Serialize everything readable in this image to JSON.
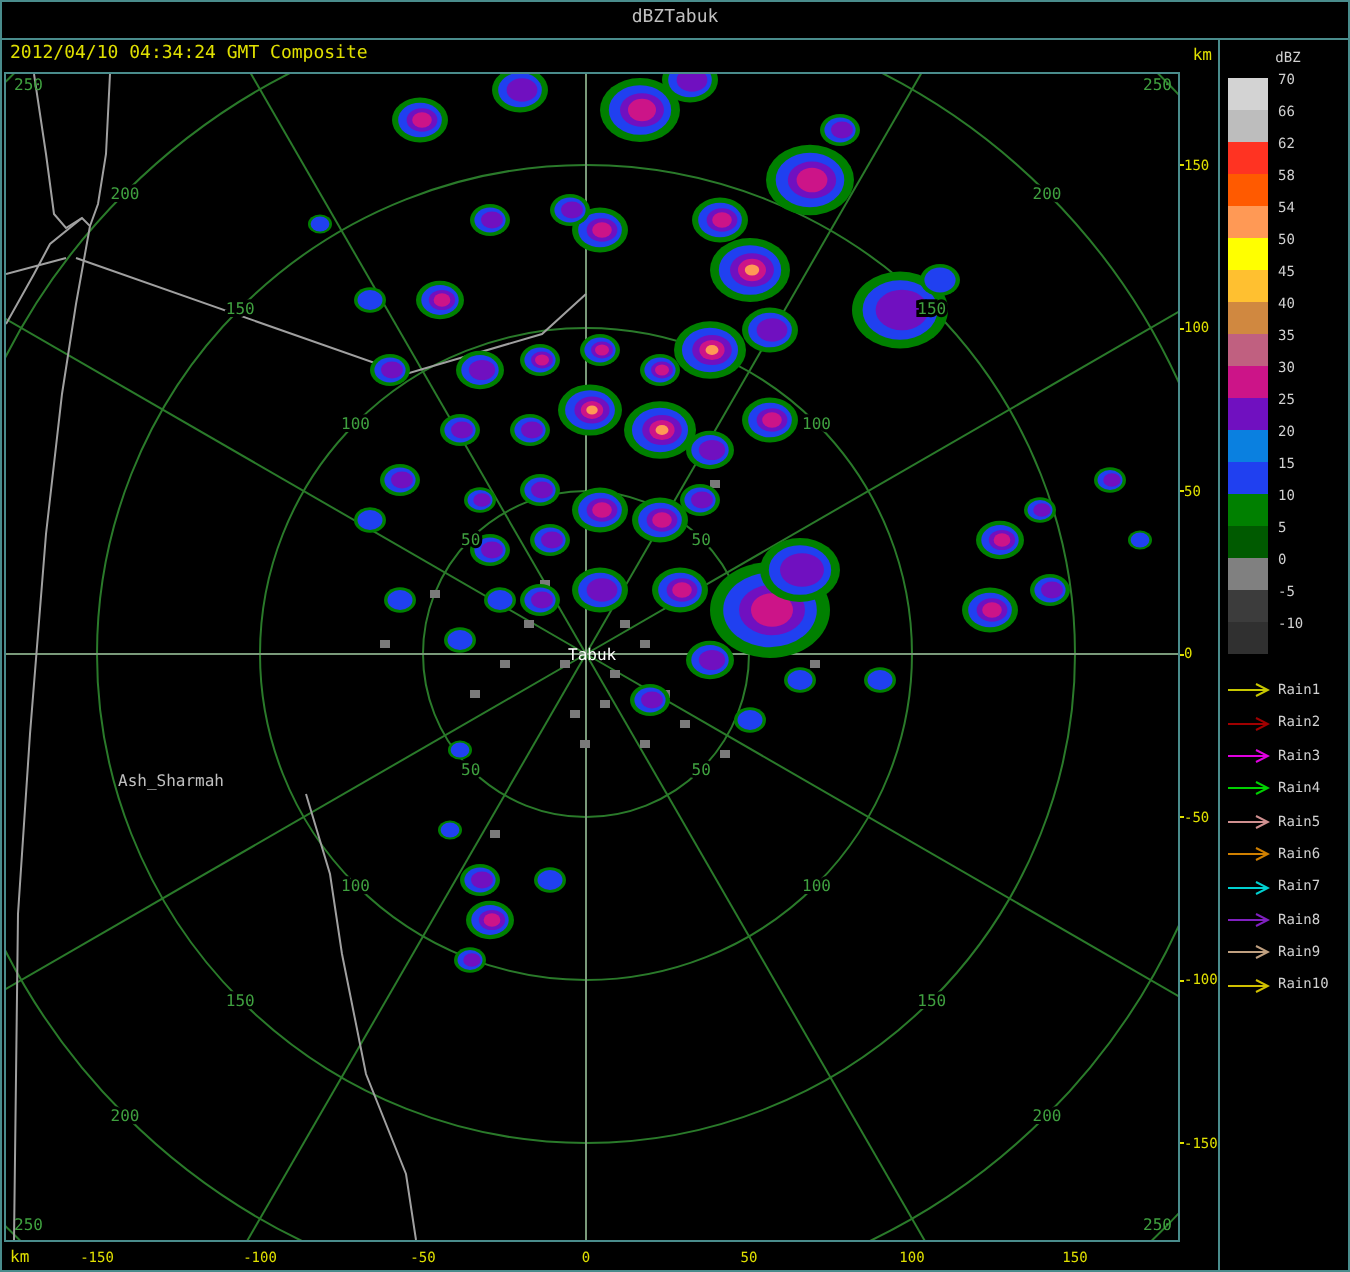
{
  "window": {
    "title": "dBZTabuk"
  },
  "header": {
    "timestamp": "2012/04/10 04:34:24 GMT Composite",
    "unit": "km"
  },
  "map": {
    "range_rings": [
      {
        "labels": [
          "50",
          "50",
          "50",
          "50"
        ]
      },
      {
        "labels": [
          "100",
          "100",
          "100",
          "100"
        ]
      },
      {
        "labels": [
          "150",
          "150",
          "150",
          "150"
        ]
      },
      {
        "labels": [
          "200",
          "200",
          "200",
          "200"
        ]
      }
    ],
    "corner_labels": [
      "250",
      "250",
      "250",
      "250"
    ],
    "places": [
      {
        "kind": "radar",
        "name": "Tabuk"
      },
      {
        "kind": "town",
        "name": "Ash_Sharmah"
      }
    ]
  },
  "y_axis": {
    "ticks": [
      "150",
      "100",
      "50",
      "0",
      "-50",
      "-100",
      "-150"
    ]
  },
  "x_axis": {
    "unit": "km",
    "ticks": [
      "-150",
      "-100",
      "-50",
      "0",
      "50",
      "100",
      "150"
    ]
  },
  "legend": {
    "title": "dBZ",
    "scale": [
      {
        "label": "70",
        "color": "#d3d3d3"
      },
      {
        "label": "66",
        "color": "#bdbdbd"
      },
      {
        "label": "62",
        "color": "#ff3322"
      },
      {
        "label": "58",
        "color": "#ff5a00"
      },
      {
        "label": "54",
        "color": "#ff9955"
      },
      {
        "label": "50",
        "color": "#ffff00"
      },
      {
        "label": "45",
        "color": "#ffc030"
      },
      {
        "label": "40",
        "color": "#d08840"
      },
      {
        "label": "35",
        "color": "#c06080"
      },
      {
        "label": "30",
        "color": "#cc1488"
      },
      {
        "label": "25",
        "color": "#7010c0"
      },
      {
        "label": "20",
        "color": "#0a80e0"
      },
      {
        "label": "15",
        "color": "#2040f0"
      },
      {
        "label": "10",
        "color": "#008000"
      },
      {
        "label": "5",
        "color": "#005a00"
      },
      {
        "label": "0",
        "color": "#808080"
      },
      {
        "label": "-5",
        "color": "#3c3c3c"
      },
      {
        "label": "-10",
        "color": "#303030"
      }
    ],
    "tracks": [
      {
        "label": "Rain1",
        "color": "#c8c800"
      },
      {
        "label": "Rain2",
        "color": "#a00000"
      },
      {
        "label": "Rain3",
        "color": "#e000e0"
      },
      {
        "label": "Rain4",
        "color": "#00d000"
      },
      {
        "label": "Rain5",
        "color": "#d09090"
      },
      {
        "label": "Rain6",
        "color": "#d08000"
      },
      {
        "label": "Rain7",
        "color": "#00d0d0"
      },
      {
        "label": "Rain8",
        "color": "#8020c0"
      },
      {
        "label": "Rain9",
        "color": "#c0a080"
      },
      {
        "label": "Rain10",
        "color": "#d0c000"
      }
    ]
  }
}
